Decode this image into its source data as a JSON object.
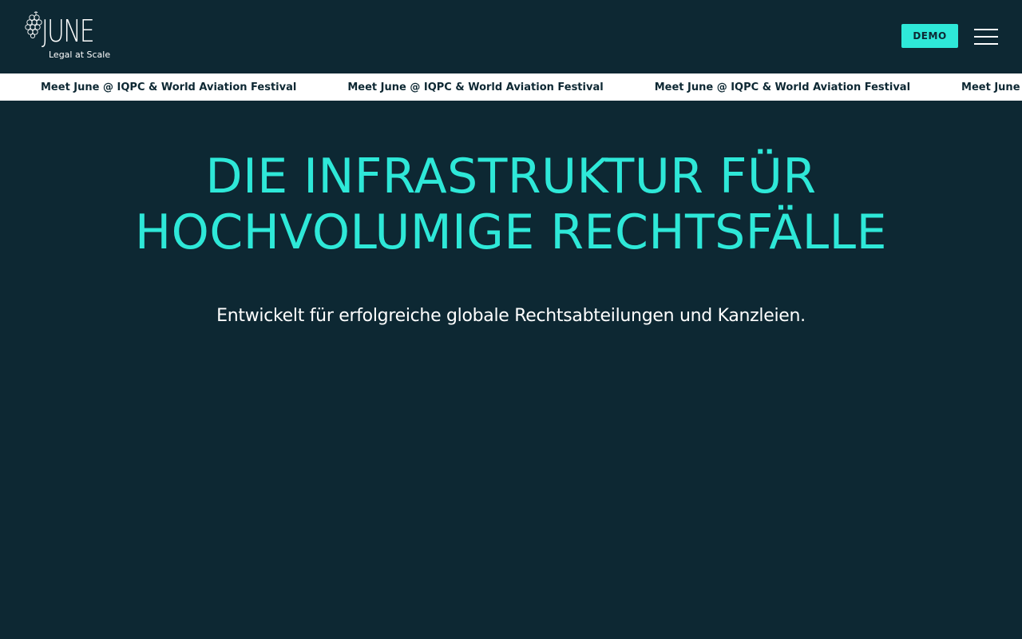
{
  "header": {
    "logo": {
      "wordmark": "JUNE",
      "tagline": "Legal at Scale"
    },
    "demo_label": "DEMO",
    "menu_icon": "hamburger-menu-icon"
  },
  "ticker": {
    "items": [
      "Meet June @ IQPC & World Aviation Festival",
      "Meet June @ IQPC & World Aviation Festival",
      "Meet June @ IQPC & World Aviation Festival",
      "Meet June @ IQPC & World Aviation Festival"
    ]
  },
  "hero": {
    "title_line1": "DIE INFRASTRUKTUR FÜR",
    "title_line2": "HOCHVOLUMIGE RECHTSFÄLLE",
    "subtitle": "Entwickelt für erfolgreiche globale Rechtsabteilungen und Kanzleien."
  },
  "colors": {
    "background": "#0d2833",
    "accent": "#2ee8d8",
    "ticker_background": "#ffffff",
    "text": "#ffffff"
  }
}
